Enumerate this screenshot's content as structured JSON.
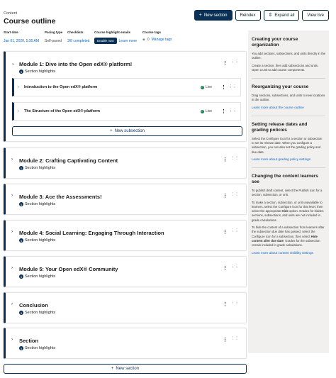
{
  "header": {
    "eyebrow": "Content",
    "title": "Course outline",
    "buttons": {
      "new_section": "New section",
      "reindex": "Reindex",
      "expand_all": "Expand all",
      "view_live": "View live"
    }
  },
  "meta": {
    "start_date_label": "Start date",
    "start_date_value": "Jan 01, 2020, 5:30 AM",
    "pacing_label": "Pacing type",
    "pacing_value": "Self-paced",
    "checklists_label": "Checklists",
    "checklists_value": "3/8 completed",
    "highlight_label": "Course highlight emails",
    "highlight_enable": "Enable now",
    "highlight_learn": "Learn more",
    "tags_label": "Course tags",
    "tags_count": "0",
    "tags_manage": "Manage tags"
  },
  "outline": {
    "highlight_count": "5",
    "highlight_text": "Section highlights",
    "live_text": "Live",
    "new_subsection": "New subsection",
    "new_section": "New section",
    "sections": [
      {
        "title": "Module 1: Dive into the Open edX® platform!"
      },
      {
        "title": "Module 2: Crafting Captivating Content"
      },
      {
        "title": "Module 3: Ace the Assessments!"
      },
      {
        "title": "Module 4: Social Learning: Engaging Through Interaction"
      },
      {
        "title": "Module 5: Your Open edX® Community"
      },
      {
        "title": "Conclusion"
      },
      {
        "title": "Section"
      }
    ],
    "subsections": [
      {
        "title": "Introduction to the Open edX® platform"
      },
      {
        "title": "The Structure of the Open edX® platform"
      }
    ]
  },
  "sidebar": {
    "org_title": "Creating your course organization",
    "org_p1": "You add sections, subsections, and units directly in the outline.",
    "org_p2": "Create a section, then add subsections and units. Open a unit to add course components.",
    "reorg_title": "Reorganizing your course",
    "reorg_p1": "Drag sections, subsections, and units to new locations in the outline.",
    "reorg_link": "Learn more about the course outline",
    "release_title": "Setting release dates and grading policies",
    "release_p1": "Select the Configure icon for a section or subsection to set its release date. When you configure a subsection, you can also set the grading policy and due date.",
    "release_link": "Learn more about grading policy settings",
    "visibility_title": "Changing the content learners see",
    "vis_p1": "To publish draft content, select the Publish icon for a section, subsection, or unit.",
    "vis_p2_a": "To make a section, subsection, or unit unavailable to learners, select the Configure icon for that level, then select the appropriate ",
    "vis_p2_b": "Hide",
    "vis_p2_c": " option. Grades for hidden sections, subsections, and units are not included in grade calculations.",
    "vis_p3_a": "To hide the content of a subsection from learners after the subsection due date has passed, select the Configure icon for a subsection, then select ",
    "vis_p3_b": "Hide content after due date",
    "vis_p3_c": ". Grades for the subsection remain included in grade calculations.",
    "vis_link": "Learn more about content visibility settings"
  },
  "icons": {
    "plus": "plus-icon",
    "expand": "arrows-expand-icon",
    "kebab": "more-vertical-icon",
    "drag": "drag-handle-icon",
    "live": "check-circle-icon",
    "tag": "tag-icon"
  },
  "colors": {
    "brand": "#0a3055",
    "link": "#0a66c2",
    "live": "#178253",
    "sidebar_bg": "#f2f0ef"
  }
}
